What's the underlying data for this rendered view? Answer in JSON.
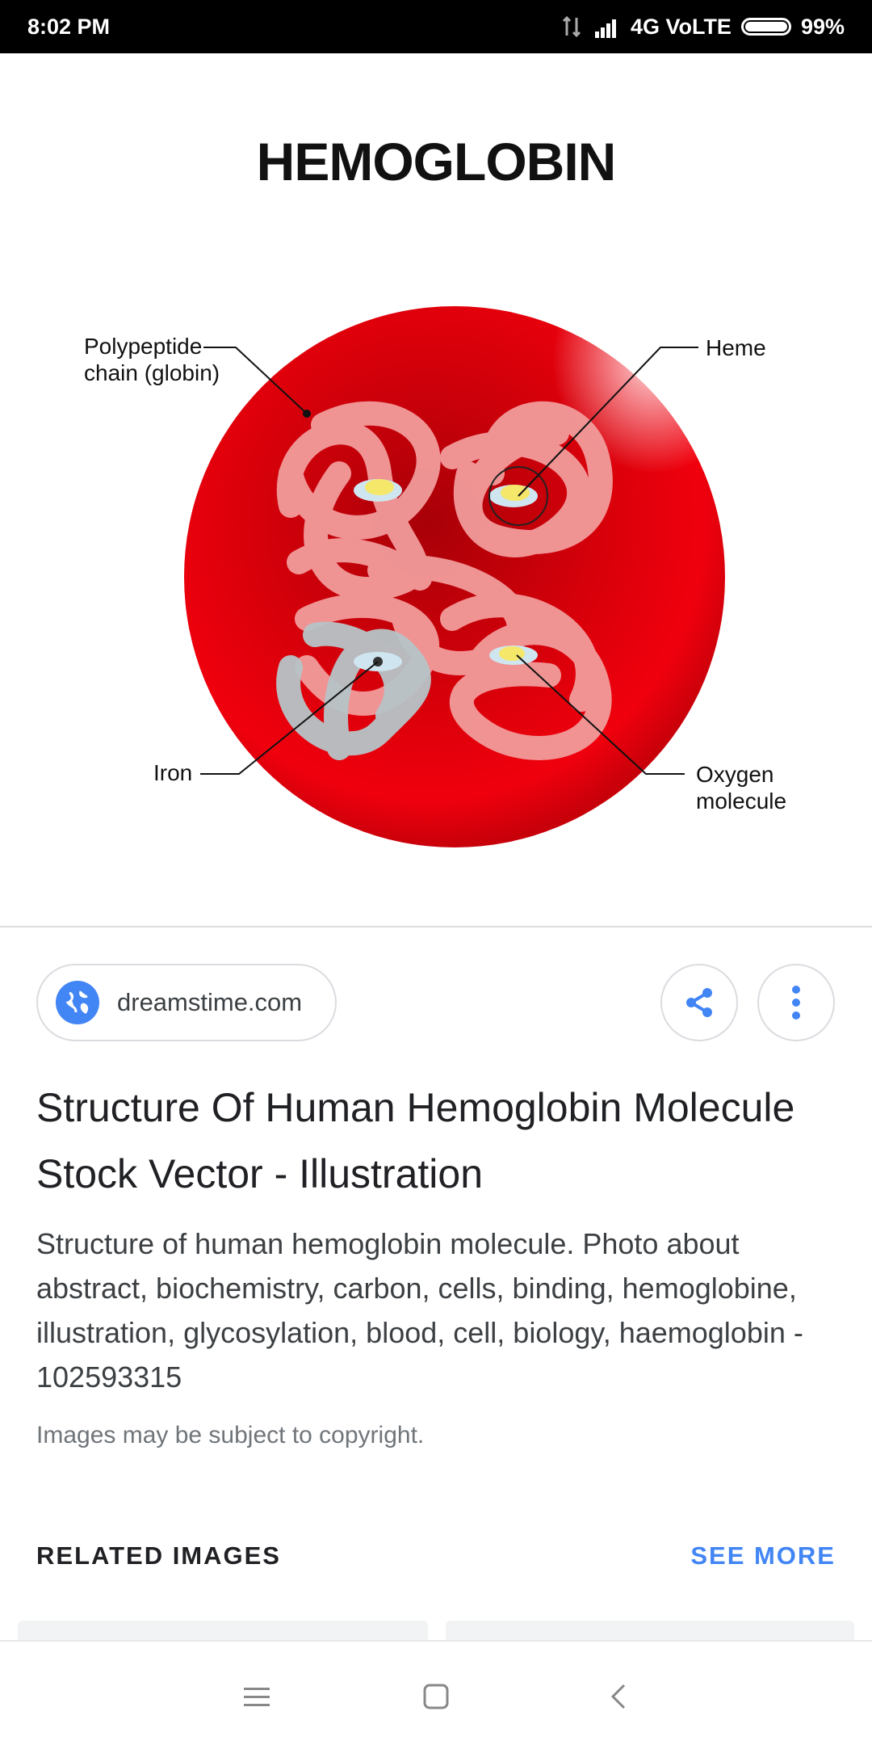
{
  "status_bar": {
    "time": "8:02 PM",
    "network": "4G VoLTE",
    "battery": "99%",
    "battery_level": 0.99
  },
  "image": {
    "title": "HEMOGLOBIN",
    "labels": {
      "polypeptide": [
        "Polypeptide",
        "chain (globin)"
      ],
      "heme": "Heme",
      "iron": "Iron",
      "oxygen": [
        "Oxygen",
        "molecule"
      ]
    },
    "colors": {
      "cell": "#e8000b",
      "chain": "#f4a0a0",
      "gray_chain": "#b7c4c7",
      "heme": "#f5e76a"
    }
  },
  "source": {
    "label": "dreamstime.com",
    "icon": "globe-icon"
  },
  "actions": {
    "share_icon": "share-icon",
    "more_icon": "more-vert-icon"
  },
  "result": {
    "title": "Structure Of Human Hemoglobin Molecule Stock Vector - Illustration",
    "description": "Structure of human hemoglobin molecule. Photo about abstract, biochemistry, carbon, cells, binding, hemoglobine, illustration, glycosylation, blood, cell, biology, haemoglobin - 102593315",
    "copyright": "Images may be subject to copyright."
  },
  "related": {
    "label": "RELATED IMAGES",
    "see_more": "SEE MORE"
  },
  "accent_color": "#4285f4"
}
